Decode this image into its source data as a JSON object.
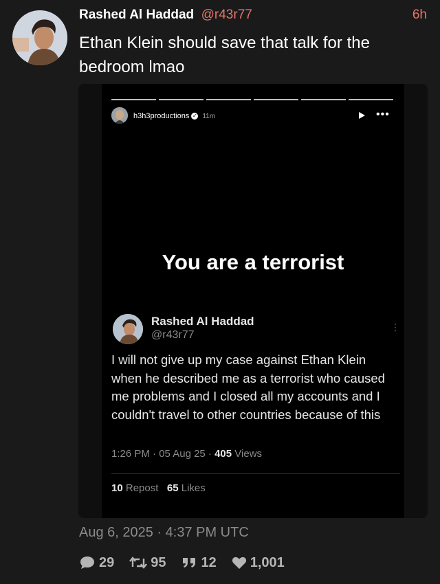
{
  "post": {
    "display_name": "Rashed Al Haddad",
    "handle": "@r43r77",
    "age": "6h",
    "text": "Ethan Klein should save that talk for the bedroom lmao",
    "timestamp": "Aug 6, 2025 · 4:37 PM UTC"
  },
  "story": {
    "username": "h3h3productions",
    "verified_icon": "check-badge-icon",
    "time": "11m",
    "play_icon": "play-icon",
    "more_icon": "more-options-icon",
    "caption": "You are a terrorist"
  },
  "embedded_tweet": {
    "name": "Rashed Al Haddad",
    "handle": "@r43r77",
    "text": "I will not give up my case against Ethan Klein when he described me as a terrorist who caused me problems and I closed all my accounts and I couldn't travel to other countries because of this",
    "time": "1:26 PM · 05 Aug 25 · ",
    "views_count": "405",
    "views_label": " Views",
    "reposts_count": "10",
    "reposts_label": " Repost",
    "likes_count": "65",
    "likes_label": " Likes"
  },
  "actions": {
    "replies": "29",
    "retweets": "95",
    "quotes": "12",
    "likes": "1,001"
  },
  "colors": {
    "accent": "#e8756a",
    "background": "#1a1a1a",
    "muted": "#8a8a8a"
  }
}
